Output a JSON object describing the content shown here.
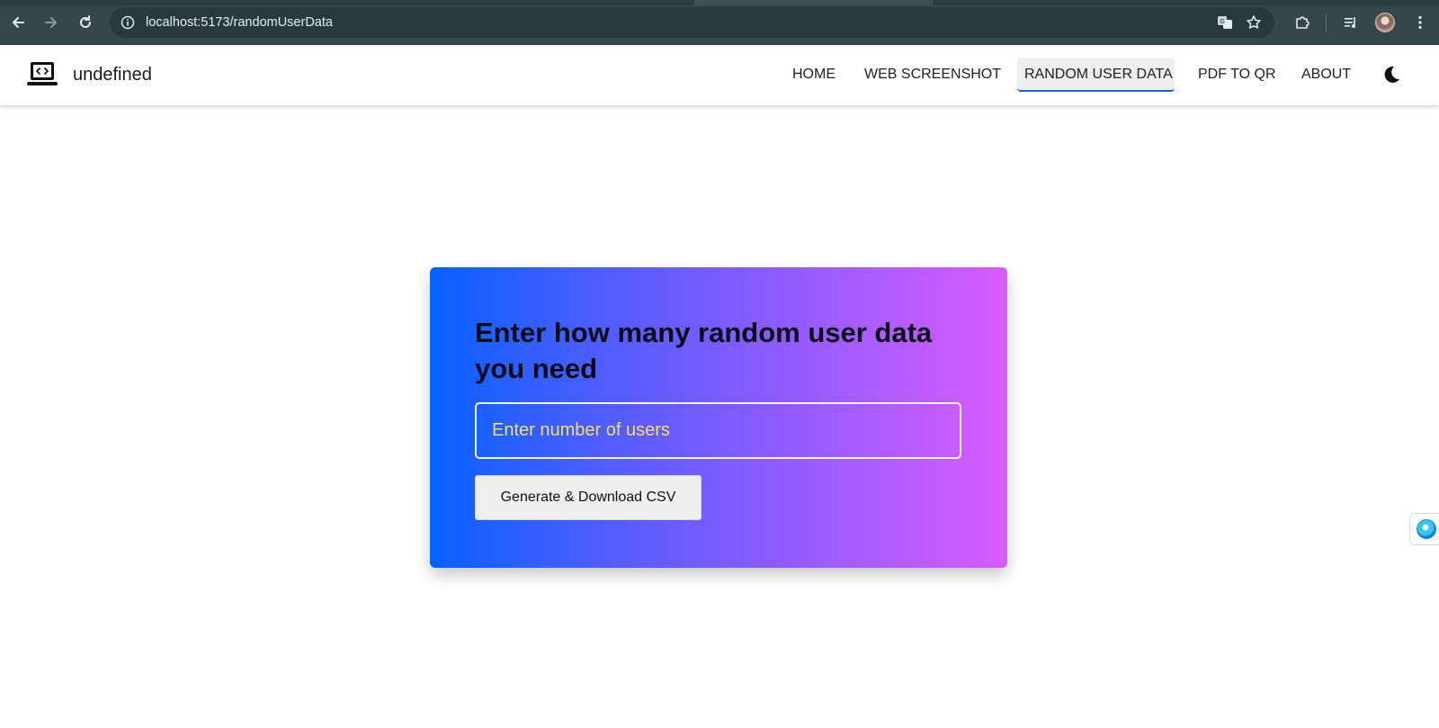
{
  "browser": {
    "url": "localhost:5173/randomUserData",
    "icons": {
      "back": "arrow-left-icon",
      "forward": "arrow-right-icon",
      "reload": "reload-icon",
      "site_info": "info-icon",
      "translate": "translate-icon",
      "bookmark": "star-icon",
      "extensions": "puzzle-icon",
      "media": "media-queue-icon",
      "profile": "avatar",
      "menu": "kebab-menu-icon"
    }
  },
  "app": {
    "brand": "undefined",
    "logo_icon": "laptop-code-icon",
    "nav": [
      {
        "label": "HOME",
        "active": false
      },
      {
        "label": "WEB SCREENSHOT",
        "active": false
      },
      {
        "label": "RANDOM USER DATA",
        "active": true
      },
      {
        "label": "PDF TO QR",
        "active": false
      },
      {
        "label": "ABOUT",
        "active": false
      }
    ],
    "theme_icon": "moon-icon"
  },
  "card": {
    "title": "Enter how many random user data you need",
    "input_placeholder": "Enter number of users",
    "input_value": "",
    "button_label": "Generate & Download CSV"
  },
  "side_widget": {
    "icon": "assistant-orb-icon"
  },
  "colors": {
    "chrome_bg": "#35474a",
    "omnibox_bg": "#283a3d",
    "active_nav_underline": "#1a64d8",
    "card_gradient_start": "#0661ff",
    "card_gradient_end": "#d95bff",
    "placeholder": "#f2dd6f"
  }
}
